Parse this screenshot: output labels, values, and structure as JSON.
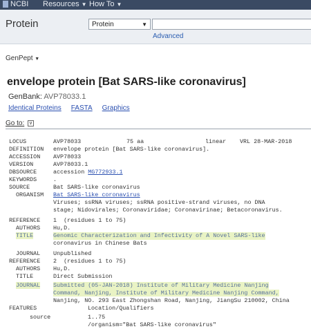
{
  "topbar": {
    "logo": "NCBI",
    "menus": [
      "Resources",
      "How To"
    ]
  },
  "search": {
    "database_label": "Protein",
    "selected_db": "Protein",
    "advanced": "Advanced"
  },
  "format": {
    "label": "GenPept"
  },
  "record": {
    "title": "envelope protein [Bat SARS-like coronavirus]",
    "genbank_label": "GenBank:",
    "genbank_accession": "AVP78033.1",
    "links": [
      "Identical Proteins",
      "FASTA",
      "Graphics"
    ],
    "goto": "Go to:"
  },
  "flatfile": {
    "locus": {
      "key": "LOCUS",
      "name": "AVP78033",
      "length": "75 aa",
      "topology": "linear",
      "division_date": "VRL 28-MAR-2018"
    },
    "definition": {
      "key": "DEFINITION",
      "value": "envelope protein [Bat SARS-like coronavirus]."
    },
    "accession": {
      "key": "ACCESSION",
      "value": "AVP78033"
    },
    "version": {
      "key": "VERSION",
      "value": "AVP78033.1"
    },
    "dbsource": {
      "key": "DBSOURCE",
      "prefix": "accession ",
      "link": "MG772933.1"
    },
    "keywords": {
      "key": "KEYWORDS",
      "value": "."
    },
    "source": {
      "key": "SOURCE",
      "value": "Bat SARS-like coronavirus"
    },
    "organism": {
      "key": "ORGANISM",
      "name": "Bat SARS-like coronavirus",
      "lineage": [
        "Viruses; ssRNA viruses; ssRNA positive-strand viruses, no DNA",
        "stage; Nidovirales; Coronaviridae; Coronavirinae; Betacoronavirus."
      ]
    },
    "reference1": {
      "key": "REFERENCE",
      "value": "1  (residues 1 to 75)",
      "authors_key": "AUTHORS",
      "authors": "Hu,D.",
      "title_key": "TITLE",
      "title": [
        "Genomic Characterization and Infectivity of A Novel SARS-like",
        "coronavirus in Chinese Bats"
      ],
      "journal_key": "JOURNAL",
      "journal": "Unpublished"
    },
    "reference2": {
      "key": "REFERENCE",
      "value": "2  (residues 1 to 75)",
      "authors_key": "AUTHORS",
      "authors": "Hu,D.",
      "title_key": "TITLE",
      "title": "Direct Submission",
      "journal_key": "JOURNAL",
      "journal": [
        "Submitted (05-JAN-2018) Institute of Military Medicine Nanjing",
        "Command, Nanjing, Institute of Military Medicine Nanjing Command,",
        "Nanjing, NO. 293 East Zhongshan Road, Nanjing, JiangSu 210002, China"
      ]
    },
    "features": {
      "key": "FEATURES",
      "header": "Location/Qualifiers",
      "source_key": "source",
      "source_range": "1..75",
      "organism_qualifier": "/organism=\"Bat SARS-like coronavirus\""
    }
  }
}
